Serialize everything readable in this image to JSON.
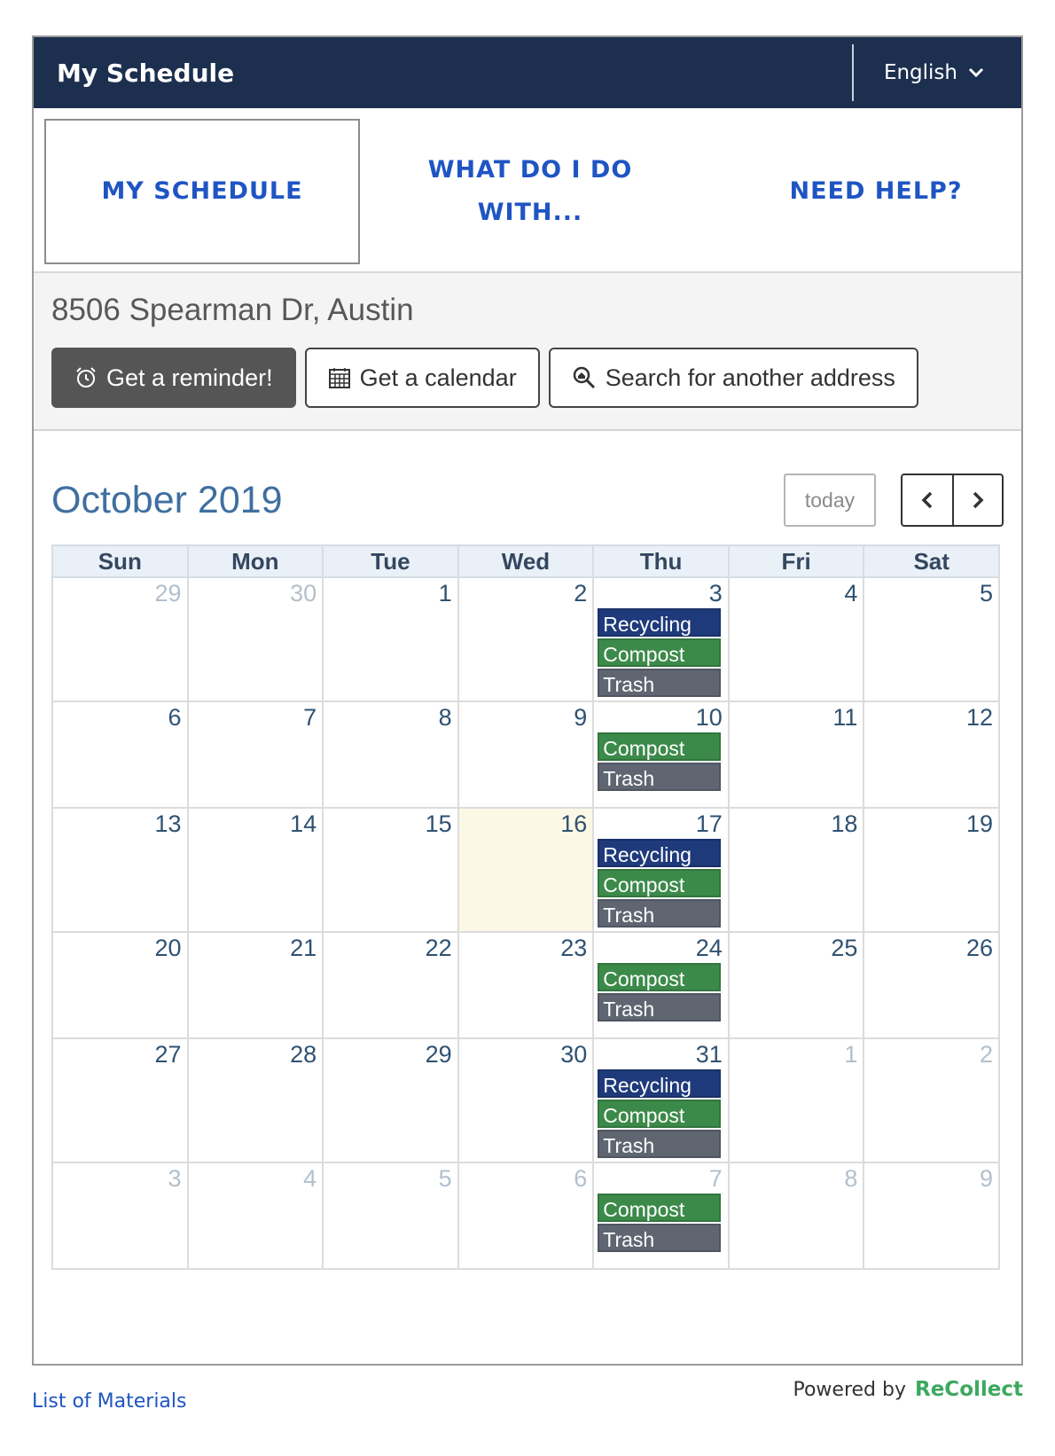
{
  "header": {
    "title": "My Schedule",
    "language": "English"
  },
  "tabs": {
    "schedule": "MY SCHEDULE",
    "what": "WHAT DO I DO WITH...",
    "help": "NEED HELP?"
  },
  "address": "8506 Spearman Dr, Austin",
  "buttons": {
    "reminder": "Get a reminder!",
    "calendar": "Get a calendar",
    "search": "Search for another address"
  },
  "calendar": {
    "title": "October 2019",
    "today_label": "today",
    "weekdays": [
      "Sun",
      "Mon",
      "Tue",
      "Wed",
      "Thu",
      "Fri",
      "Sat"
    ],
    "weeks": [
      [
        {
          "d": "29",
          "o": true
        },
        {
          "d": "30",
          "o": true
        },
        {
          "d": "1"
        },
        {
          "d": "2"
        },
        {
          "d": "3",
          "ev": [
            "Recycling",
            "Compost",
            "Trash"
          ]
        },
        {
          "d": "4"
        },
        {
          "d": "5"
        }
      ],
      [
        {
          "d": "6"
        },
        {
          "d": "7"
        },
        {
          "d": "8"
        },
        {
          "d": "9"
        },
        {
          "d": "10",
          "ev": [
            "Compost",
            "Trash"
          ]
        },
        {
          "d": "11"
        },
        {
          "d": "12"
        }
      ],
      [
        {
          "d": "13"
        },
        {
          "d": "14"
        },
        {
          "d": "15"
        },
        {
          "d": "16",
          "today": true
        },
        {
          "d": "17",
          "ev": [
            "Recycling",
            "Compost",
            "Trash"
          ]
        },
        {
          "d": "18"
        },
        {
          "d": "19"
        }
      ],
      [
        {
          "d": "20"
        },
        {
          "d": "21"
        },
        {
          "d": "22"
        },
        {
          "d": "23"
        },
        {
          "d": "24",
          "ev": [
            "Compost",
            "Trash"
          ]
        },
        {
          "d": "25"
        },
        {
          "d": "26"
        }
      ],
      [
        {
          "d": "27"
        },
        {
          "d": "28"
        },
        {
          "d": "29"
        },
        {
          "d": "30"
        },
        {
          "d": "31",
          "ev": [
            "Recycling",
            "Compost",
            "Trash"
          ]
        },
        {
          "d": "1",
          "o": true
        },
        {
          "d": "2",
          "o": true
        }
      ],
      [
        {
          "d": "3",
          "o": true
        },
        {
          "d": "4",
          "o": true
        },
        {
          "d": "5",
          "o": true
        },
        {
          "d": "6",
          "o": true
        },
        {
          "d": "7",
          "o": true,
          "ev": [
            "Compost",
            "Trash"
          ]
        },
        {
          "d": "8",
          "o": true
        },
        {
          "d": "9",
          "o": true
        }
      ]
    ]
  },
  "colors": {
    "header_bg": "#1c2f4f",
    "link": "#1f55c3",
    "recycling": "#1e3a7b",
    "compost": "#3c8a4a",
    "trash": "#5f6672",
    "today_bg": "#fbf8e6"
  },
  "footer": {
    "materials_link": "List of Materials",
    "powered_by": "Powered by",
    "brand": "ReCollect"
  }
}
